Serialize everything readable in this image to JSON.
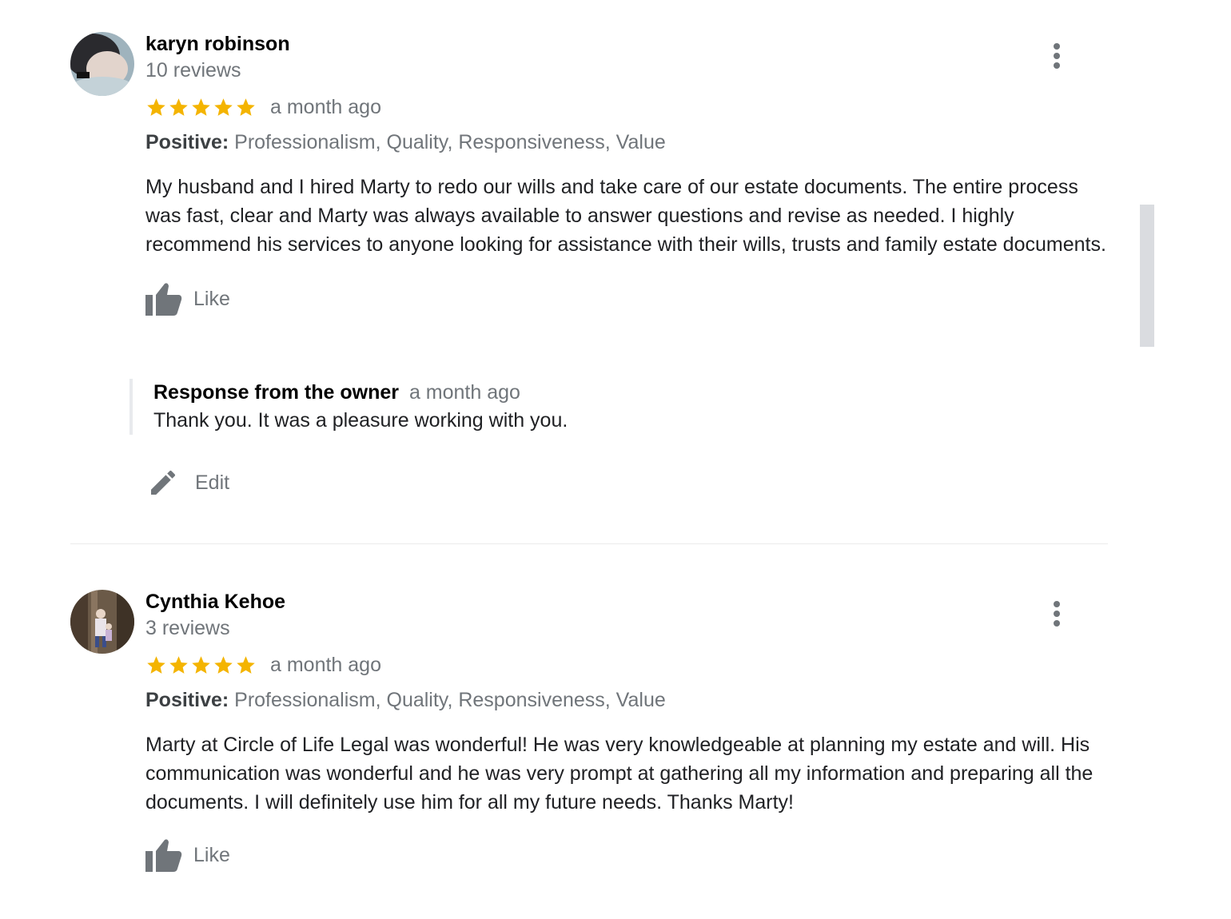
{
  "reviews": [
    {
      "author": "karyn robinson",
      "review_count": "10 reviews",
      "rating": 5,
      "time": "a month ago",
      "positive_label": "Positive:",
      "positive_values": "Professionalism, Quality, Responsiveness, Value",
      "text": "My husband and I hired Marty to redo our wills and take care of our estate documents. The entire process was fast, clear and Marty was always available to answer questions and revise as needed. I highly recommend his services to anyone looking for assistance with their wills, trusts and family estate documents.",
      "like_label": "Like",
      "owner_response": {
        "title": "Response from the owner",
        "time": "a month ago",
        "text": "Thank you. It was a pleasure working with you."
      },
      "edit_label": "Edit"
    },
    {
      "author": "Cynthia Kehoe",
      "review_count": "3 reviews",
      "rating": 5,
      "time": "a month ago",
      "positive_label": "Positive:",
      "positive_values": "Professionalism, Quality, Responsiveness, Value",
      "text": "Marty at Circle of Life Legal was wonderful! He was very knowledgeable at planning my estate and will. His communication was wonderful and he was very prompt at gathering all my information and preparing all the documents. I will definitely use him for all my future needs. Thanks Marty!",
      "like_label": "Like"
    }
  ],
  "icons": {
    "star": "star-icon",
    "like": "thumb-up-icon",
    "edit": "pencil-icon",
    "more": "more-vert-icon"
  },
  "colors": {
    "star": "#f4b400",
    "muted_text": "#70757a",
    "icon": "#70757a"
  }
}
